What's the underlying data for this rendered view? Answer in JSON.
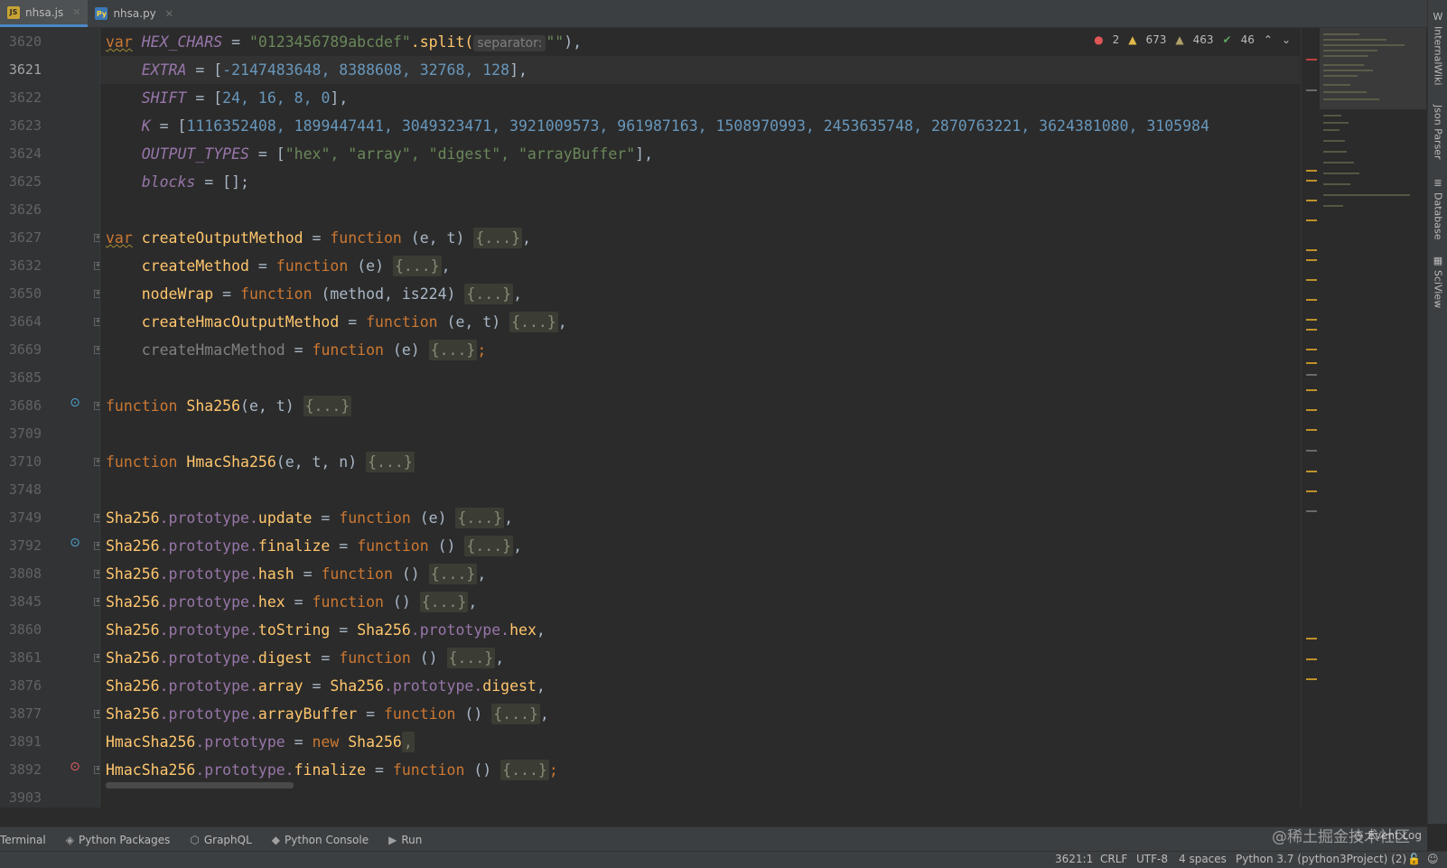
{
  "tabs": [
    {
      "label": "nhsa.js",
      "icon": "javascript-file-icon",
      "active": true
    },
    {
      "label": "nhsa.py",
      "icon": "python-file-icon",
      "active": false
    }
  ],
  "gutter": {
    "line_numbers": [
      "3620",
      "3621",
      "3622",
      "3623",
      "3624",
      "3625",
      "3626",
      "3627",
      "3632",
      "3650",
      "3664",
      "3669",
      "3685",
      "3686",
      "3709",
      "3710",
      "3748",
      "3749",
      "3792",
      "3808",
      "3845",
      "3860",
      "3861",
      "3876",
      "3877",
      "3891",
      "3892",
      "3903"
    ],
    "current_line": "3621"
  },
  "code": {
    "hint_separator": "separator:",
    "l3620": {
      "kw": "var",
      "name": "HEX_CHARS",
      "eq": " = ",
      "str": "\"0123456789abcdef\"",
      "call": ".split(",
      "arg": "\"\"",
      "end": "),"
    },
    "l3621": {
      "name": "EXTRA",
      "eq": " = [",
      "nums": "-2147483648, 8388608, 32768, 128",
      "end": "],"
    },
    "l3622": {
      "name": "SHIFT",
      "eq": " = [",
      "nums": "24, 16, 8, 0",
      "end": "],"
    },
    "l3623": {
      "name": "K",
      "eq": " = [",
      "nums": "1116352408, 1899447441, 3049323471, 3921009573, 961987163, 1508970993, 2453635748, 2870763221, 3624381080, 3105984",
      "end": ""
    },
    "l3624": {
      "name": "OUTPUT_TYPES",
      "eq": " = [",
      "strs": "\"hex\", \"array\", \"digest\", \"arrayBuffer\"",
      "end": "],"
    },
    "l3625": {
      "name": "blocks",
      "eq": " = [];"
    },
    "l3627": {
      "kw": "var",
      "name": "createOutputMethod",
      "eq": " = ",
      "fn": "function",
      "params": " (e, t) ",
      "fold": "{...}",
      "end": ","
    },
    "l3632": {
      "name": "createMethod",
      "eq": " = ",
      "fn": "function",
      "params": " (e) ",
      "fold": "{...}",
      "end": ","
    },
    "l3650": {
      "name": "nodeWrap",
      "eq": " = ",
      "fn": "function",
      "params": " (method, is224) ",
      "fold": "{...}",
      "end": ","
    },
    "l3664": {
      "name": "createHmacOutputMethod",
      "eq": " = ",
      "fn": "function",
      "params": " (e, t) ",
      "fold": "{...}",
      "end": ","
    },
    "l3669": {
      "name": "createHmacMethod",
      "eq": " = ",
      "fn": "function",
      "params": " (e) ",
      "fold": "{...}",
      "end": ";"
    },
    "l3686": {
      "fn": "function",
      "name": "Sha256",
      "params": "(e, t) ",
      "fold": "{...}"
    },
    "l3710": {
      "fn": "function",
      "name": "HmacSha256",
      "params": "(e, t, n) ",
      "fold": "{...}"
    },
    "l3749": {
      "obj": "Sha256",
      "proto": ".prototype.",
      "prop": "update",
      "eq": " = ",
      "fn": "function",
      "params": " (e) ",
      "fold": "{...}",
      "end": ","
    },
    "l3792": {
      "obj": "Sha256",
      "proto": ".prototype.",
      "prop": "finalize",
      "eq": " = ",
      "fn": "function",
      "params": " () ",
      "fold": "{...}",
      "end": ","
    },
    "l3808": {
      "obj": "Sha256",
      "proto": ".prototype.",
      "prop": "hash",
      "eq": " = ",
      "fn": "function",
      "params": " () ",
      "fold": "{...}",
      "end": ","
    },
    "l3845": {
      "obj": "Sha256",
      "proto": ".prototype.",
      "prop": "hex",
      "eq": " = ",
      "fn": "function",
      "params": " () ",
      "fold": "{...}",
      "end": ","
    },
    "l3860": {
      "obj": "Sha256",
      "proto": ".prototype.",
      "prop": "toString",
      "eq": " = ",
      "obj2": "Sha256",
      "proto2": ".prototype.",
      "prop2": "hex",
      "end": ","
    },
    "l3861": {
      "obj": "Sha256",
      "proto": ".prototype.",
      "prop": "digest",
      "eq": " = ",
      "fn": "function",
      "params": " () ",
      "fold": "{...}",
      "end": ","
    },
    "l3876": {
      "obj": "Sha256",
      "proto": ".prototype.",
      "prop": "array",
      "eq": " = ",
      "obj2": "Sha256",
      "proto2": ".prototype.",
      "prop2": "digest",
      "end": ","
    },
    "l3877": {
      "obj": "Sha256",
      "proto": ".prototype.",
      "prop": "arrayBuffer",
      "eq": " = ",
      "fn": "function",
      "params": " () ",
      "fold": "{...}",
      "end": ","
    },
    "l3891": {
      "obj": "HmacSha256",
      "proto": ".prototype",
      "eq": " = ",
      "kw": "new",
      "obj2": "Sha256",
      "end": ","
    },
    "l3892": {
      "obj": "HmacSha256",
      "proto": ".prototype.",
      "prop": "finalize",
      "eq": " = ",
      "fn": "function",
      "params": " () ",
      "fold": "{...}",
      "end": ";"
    }
  },
  "inspections": {
    "errors": "2",
    "warnings": "673",
    "weak_warnings": "463",
    "typos": "46"
  },
  "right_tools": [
    "InternalWiki",
    "Json Parser",
    "Database",
    "SciView"
  ],
  "bottom_tools": [
    "Terminal",
    "Python Packages",
    "GraphQL",
    "Python Console",
    "Run"
  ],
  "event_log": "Event Log",
  "status": {
    "position": "3621:1",
    "line_sep": "CRLF",
    "encoding": "UTF-8",
    "indent": "4 spaces",
    "interpreter": "Python 3.7 (python3Project) (2)"
  },
  "watermark": "@稀土掘金技术社区",
  "colors": {
    "keyword": "#cc7832",
    "function_name": "#ffc66d",
    "string": "#6a8759",
    "number": "#6897bb",
    "property": "#9876aa",
    "background": "#2b2b2b"
  }
}
